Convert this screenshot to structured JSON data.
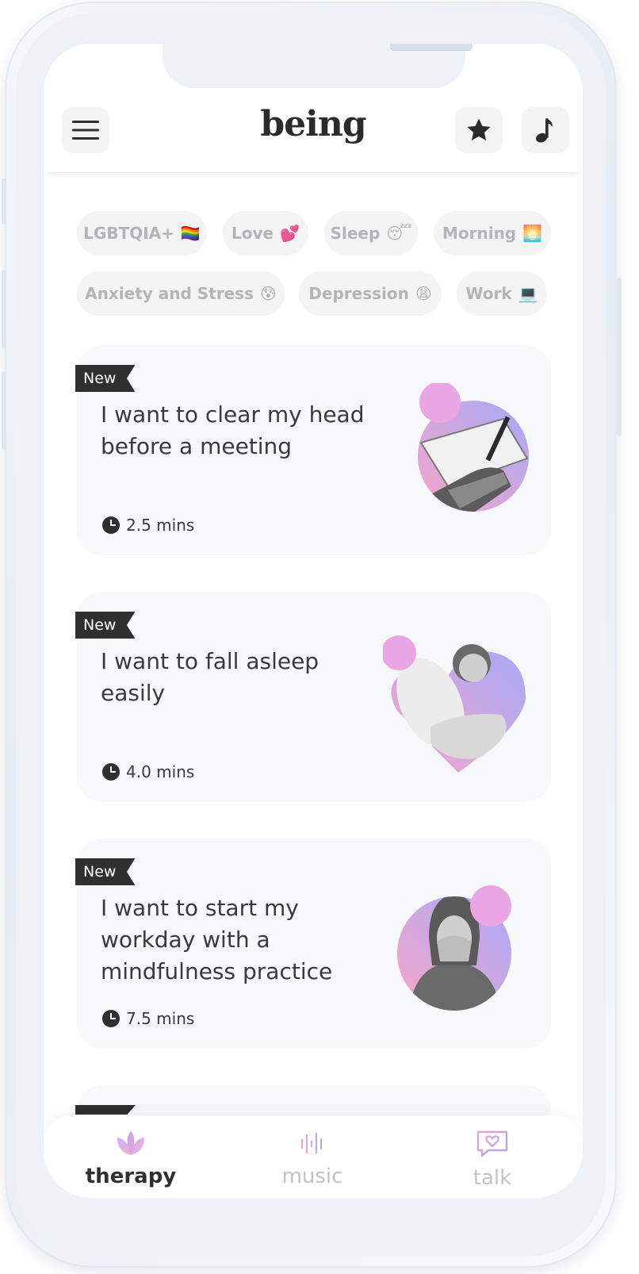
{
  "app": {
    "logo": "being"
  },
  "header": {
    "menu_icon": "menu-icon",
    "favorites_icon": "star-icon",
    "music_icon": "music-note-icon"
  },
  "chips": [
    {
      "label": "LGBTQIA+",
      "emoji": "🏳️‍🌈"
    },
    {
      "label": "Love",
      "emoji": "💕"
    },
    {
      "label": "Sleep",
      "emoji": "😴"
    },
    {
      "label": "Morning",
      "emoji": "🌅"
    },
    {
      "label": "Anxiety and Stress",
      "emoji": "😰"
    },
    {
      "label": "Depression",
      "emoji": "😩"
    },
    {
      "label": "Work",
      "emoji": "💻"
    }
  ],
  "cards": [
    {
      "badge": "New",
      "title": "I want to clear my head before a meeting",
      "duration": "2.5 mins"
    },
    {
      "badge": "New",
      "title": "I want to fall asleep easily",
      "duration": "4.0 mins"
    },
    {
      "badge": "New",
      "title": "I want to start my workday with a mindfulness practice",
      "duration": "7.5 mins"
    }
  ],
  "nav": [
    {
      "label": "therapy",
      "icon": "lotus-icon",
      "active": true
    },
    {
      "label": "music",
      "icon": "soundwave-icon",
      "active": false
    },
    {
      "label": "talk",
      "icon": "chat-heart-icon",
      "active": false
    }
  ],
  "colors": {
    "accent_pink": "#f5a3cf",
    "accent_purple": "#a9a6f5",
    "text_dark": "#2f2f2f",
    "chip_text": "#b4b4b8"
  }
}
